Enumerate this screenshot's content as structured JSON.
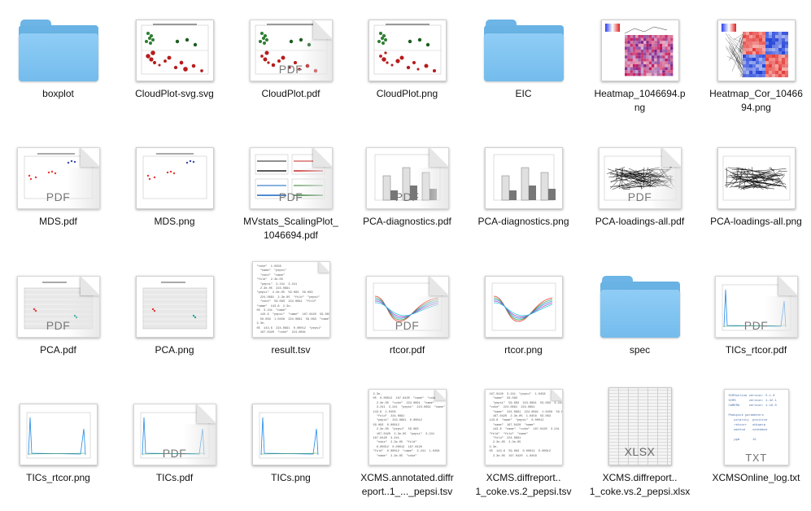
{
  "files": [
    {
      "name": "boxplot",
      "kind": "folder",
      "icon": "folder-icon"
    },
    {
      "name": "CloudPlot-svg.svg",
      "kind": "image",
      "icon": "svg-thumbnail-icon",
      "preview": "cloud"
    },
    {
      "name": "CloudPlot.pdf",
      "kind": "pdf",
      "icon": "pdf-document-icon",
      "badge": "PDF",
      "preview": "cloud"
    },
    {
      "name": "CloudPlot.png",
      "kind": "image",
      "icon": "png-thumbnail-icon",
      "preview": "cloud"
    },
    {
      "name": "EIC",
      "kind": "folder",
      "icon": "folder-icon"
    },
    {
      "name": "Heatmap_1046694.png",
      "kind": "image",
      "icon": "png-thumbnail-icon",
      "preview": "heatmap"
    },
    {
      "name": "Heatmap_Cor_1046694.png",
      "kind": "image",
      "icon": "png-thumbnail-icon",
      "preview": "corheatmap"
    },
    {
      "name": "MDS.pdf",
      "kind": "pdf",
      "icon": "pdf-document-icon",
      "badge": "PDF",
      "preview": "mds"
    },
    {
      "name": "MDS.png",
      "kind": "image",
      "icon": "png-thumbnail-icon",
      "preview": "mds"
    },
    {
      "name": "MVstats_ScalingPlot_1046694.pdf",
      "kind": "pdf",
      "icon": "pdf-document-icon",
      "badge": "PDF",
      "preview": "scaling"
    },
    {
      "name": "PCA-diagnostics.pdf",
      "kind": "pdf",
      "icon": "pdf-document-icon",
      "badge": "PDF",
      "preview": "bars"
    },
    {
      "name": "PCA-diagnostics.png",
      "kind": "image",
      "icon": "png-thumbnail-icon",
      "preview": "bars"
    },
    {
      "name": "PCA-loadings-all.pdf",
      "kind": "pdf",
      "icon": "pdf-document-icon",
      "badge": "PDF",
      "preview": "loadings"
    },
    {
      "name": "PCA-loadings-all.png",
      "kind": "image",
      "icon": "png-thumbnail-icon",
      "preview": "loadings"
    },
    {
      "name": "PCA.pdf",
      "kind": "pdf",
      "icon": "pdf-document-icon",
      "badge": "PDF",
      "preview": "pca"
    },
    {
      "name": "PCA.png",
      "kind": "image",
      "icon": "png-thumbnail-icon",
      "preview": "pca"
    },
    {
      "name": "result.tsv",
      "kind": "text",
      "icon": "tsv-document-icon",
      "preview": "result"
    },
    {
      "name": "rtcor.pdf",
      "kind": "pdf",
      "icon": "pdf-document-icon",
      "badge": "PDF",
      "preview": "rtcor"
    },
    {
      "name": "rtcor.png",
      "kind": "image",
      "icon": "png-thumbnail-icon",
      "preview": "rtcor"
    },
    {
      "name": "spec",
      "kind": "folder",
      "icon": "folder-icon"
    },
    {
      "name": "TICs_rtcor.pdf",
      "kind": "pdf",
      "icon": "pdf-document-icon",
      "badge": "PDF",
      "preview": "tics"
    },
    {
      "name": "TICs_rtcor.png",
      "kind": "image",
      "icon": "png-thumbnail-icon",
      "preview": "tics"
    },
    {
      "name": "TICs.pdf",
      "kind": "pdf",
      "icon": "pdf-document-icon",
      "badge": "PDF",
      "preview": "tics"
    },
    {
      "name": "TICs.png",
      "kind": "image",
      "icon": "png-thumbnail-icon",
      "preview": "tics"
    },
    {
      "name": "XCMS.annotated.diffreport..1_..._pepsi.tsv",
      "kind": "text",
      "icon": "tsv-document-icon",
      "preview": "diff"
    },
    {
      "name": "XCMS.diffreport..1_coke.vs.2_pepsi.tsv",
      "kind": "text",
      "icon": "tsv-document-icon",
      "preview": "diff"
    },
    {
      "name": "XCMS.diffreport..1_coke.vs.2_pepsi.xlsx",
      "kind": "xlsx",
      "icon": "xlsx-document-icon",
      "badge": "XLSX"
    },
    {
      "name": "XCMSOnline_log.txt",
      "kind": "txt",
      "icon": "txt-document-icon",
      "badge": "TXT"
    }
  ],
  "display_names": [
    "boxplot",
    "CloudPlot-svg.svg",
    "CloudPlot.pdf",
    "CloudPlot.png",
    "EIC",
    "Heatmap_1046694.p\nng",
    "Heatmap_Cor_10466\n94.png",
    "MDS.pdf",
    "MDS.png",
    "MVstats_ScalingPlot_\n1046694.pdf",
    "PCA-diagnostics.pdf",
    "PCA-diagnostics.png",
    "PCA-loadings-all.pdf",
    "PCA-loadings-all.png",
    "PCA.pdf",
    "PCA.png",
    "result.tsv",
    "rtcor.pdf",
    "rtcor.png",
    "spec",
    "TICs_rtcor.pdf",
    "TICs_rtcor.png",
    "TICs.pdf",
    "TICs.png",
    "XCMS.annotated.diffr\neport..1_..._pepsi.tsv",
    "XCMS.diffreport..\n1_coke.vs.2_pepsi.tsv",
    "XCMS.diffreport..\n1_coke.vs.2_pepsi.xlsx",
    "XCMSOnline_log.txt"
  ],
  "colors": {
    "folder": "#74bcec",
    "pdf_badge": "#777777",
    "txt_text": "#4a6fa5"
  }
}
